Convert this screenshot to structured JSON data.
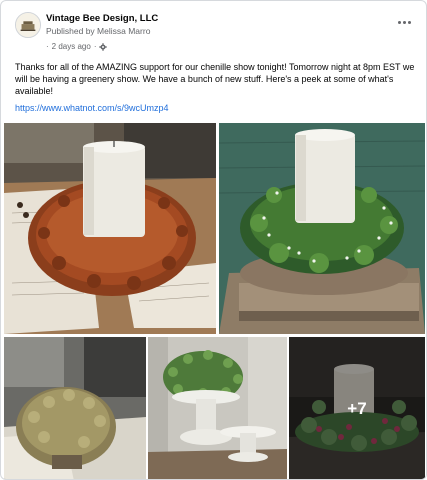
{
  "post": {
    "page_name": "Vintage Bee Design, LLC",
    "published_prefix": "Published by",
    "author": "Melissa Marro",
    "timestamp": "2 days ago",
    "separator": "·",
    "body": "Thanks for all of the AMAZING support for our chenille show tonight! Tomorrow night at 8pm EST we will be having a greenery show. We have a bunch of new stuff. Here's a peek at some of what's available!",
    "link": "https://www.whatnot.com/s/9wcUmzp4",
    "more_photos_label": "+7"
  },
  "icons": {
    "audience": "gear-icon",
    "menu": "more-horizontal-icon"
  },
  "colors": {
    "link": "#216fdb",
    "secondary_text": "#65676b"
  }
}
